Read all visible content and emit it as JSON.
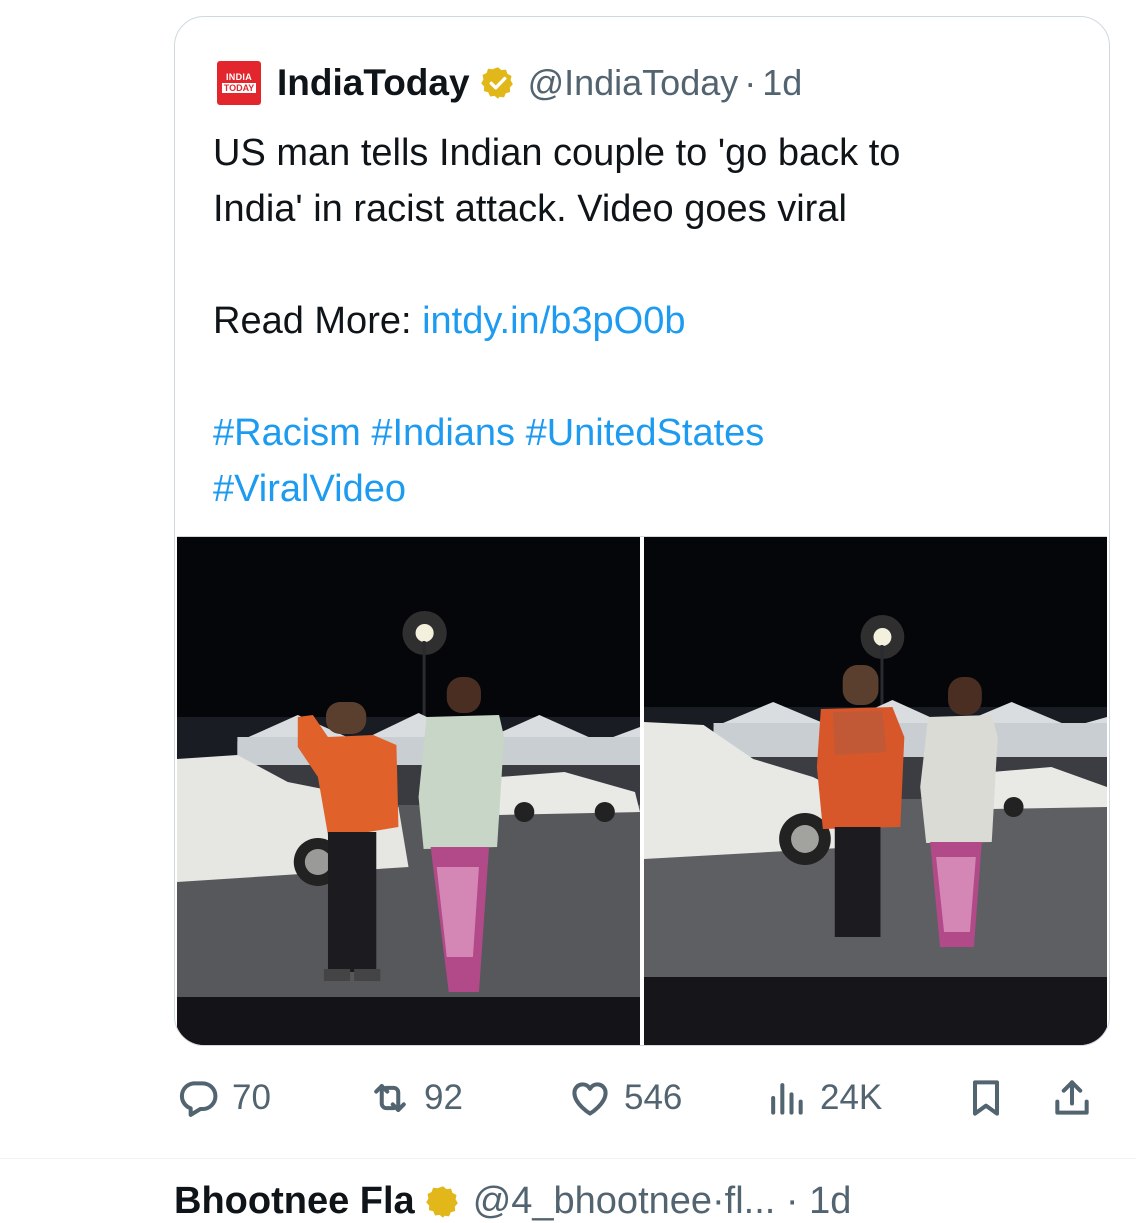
{
  "quoted_tweet": {
    "logo": {
      "line1": "INDIA",
      "line2": "TODAY",
      "color": "#e3262d"
    },
    "author_name": "IndiaToday",
    "handle": "@IndiaToday",
    "separator": "·",
    "time": "1d",
    "text_line1": "US man tells Indian couple to 'go back to",
    "text_line2": "India' in racist attack. Video goes viral",
    "read_more_label": "Read More:",
    "read_more_link": "intdy.in/b3pO0b",
    "hashtags_line1": "#Racism #Indians #UnitedStates",
    "hashtags_line2": "#ViralVideo",
    "media_count": 2
  },
  "actions": {
    "replies": "70",
    "reposts": "92",
    "likes": "546",
    "views": "24K"
  },
  "next_tweet": {
    "name_partial": "Bhootnee Fla",
    "rest_partial": "@4_bhootnee·fl... · 1d"
  },
  "colors": {
    "link": "#1d9bf0",
    "secondary_text": "#536471",
    "border": "#cfd9de",
    "verified_gold": "#e2b719"
  }
}
